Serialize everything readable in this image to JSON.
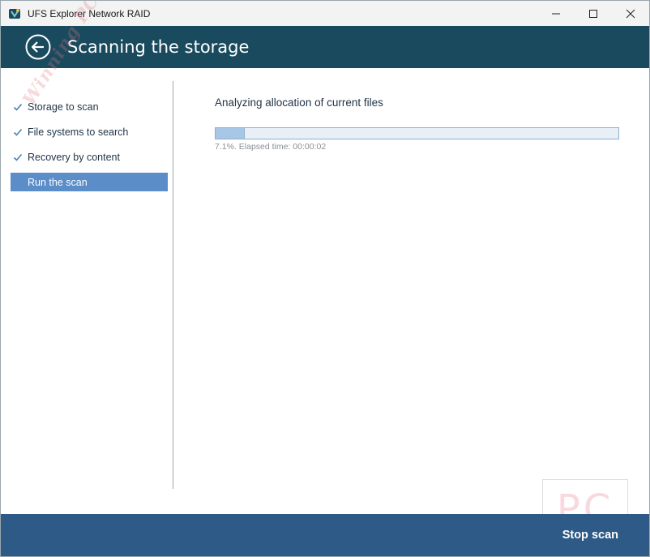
{
  "window": {
    "title": "UFS Explorer Network RAID",
    "controls": {
      "minimize": "minimize-icon",
      "maximize": "maximize-icon",
      "close": "close-icon"
    }
  },
  "header": {
    "title": "Scanning the storage",
    "back_icon": "back-arrow-icon"
  },
  "steps": [
    {
      "label": "Storage to scan",
      "done": true
    },
    {
      "label": "File systems to search",
      "done": true
    },
    {
      "label": "Recovery by content",
      "done": true
    },
    {
      "label": "Run the scan",
      "done": false,
      "active": true
    }
  ],
  "scan": {
    "status": "Analyzing allocation of current files",
    "progress_percent": 7.1,
    "progress_text": "7.1%. Elapsed time: 00:00:02"
  },
  "footer": {
    "stop_label": "Stop scan"
  },
  "watermark": {
    "diagonal_text": "Winning PC",
    "box_text": "PC"
  },
  "colors": {
    "header_bg": "#1a4a5e",
    "footer_bg": "#2d5a86",
    "active_step_bg": "#5b8dc9",
    "progress_fill": "#a8c6e6"
  }
}
